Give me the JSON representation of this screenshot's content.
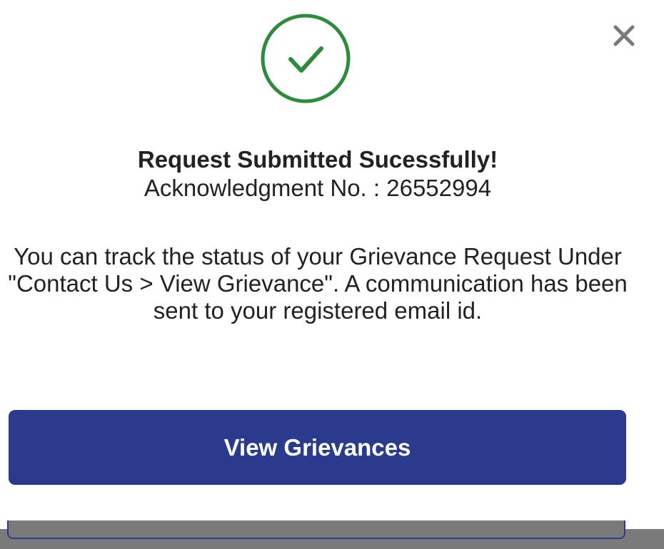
{
  "dialog": {
    "title": "Request Submitted Sucessfully!",
    "ack_label": "Acknowledgment No.",
    "ack_separator": " : ",
    "ack_number": "26552994",
    "message": "You can track the status of your Grievance Request Under \"Contact Us > View Grievance\". A communication has been sent to your registered email id.",
    "primary_button_label": "View Grievances",
    "success_icon": "check-circle-icon",
    "close_icon": "close-icon"
  },
  "colors": {
    "success": "#2e8b3d",
    "primary": "#2b3a8c",
    "text": "#222222",
    "close": "#7a7a7a",
    "backdrop": "#7a7a7a"
  }
}
